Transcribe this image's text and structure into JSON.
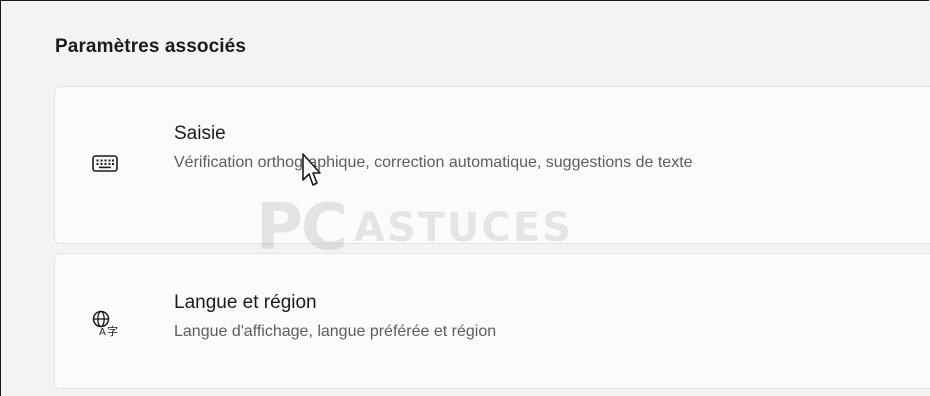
{
  "section": {
    "title": "Paramètres associés"
  },
  "cards": [
    {
      "title": "Saisie",
      "description": "Vérification orthographique, correction automatique, suggestions de texte",
      "icon": "keyboard-icon"
    },
    {
      "title": "Langue et région",
      "description": "Langue d'affichage, langue préférée et région",
      "icon": "language-icon"
    }
  ],
  "watermark": {
    "left": "PC",
    "right": "ASTUCES"
  }
}
